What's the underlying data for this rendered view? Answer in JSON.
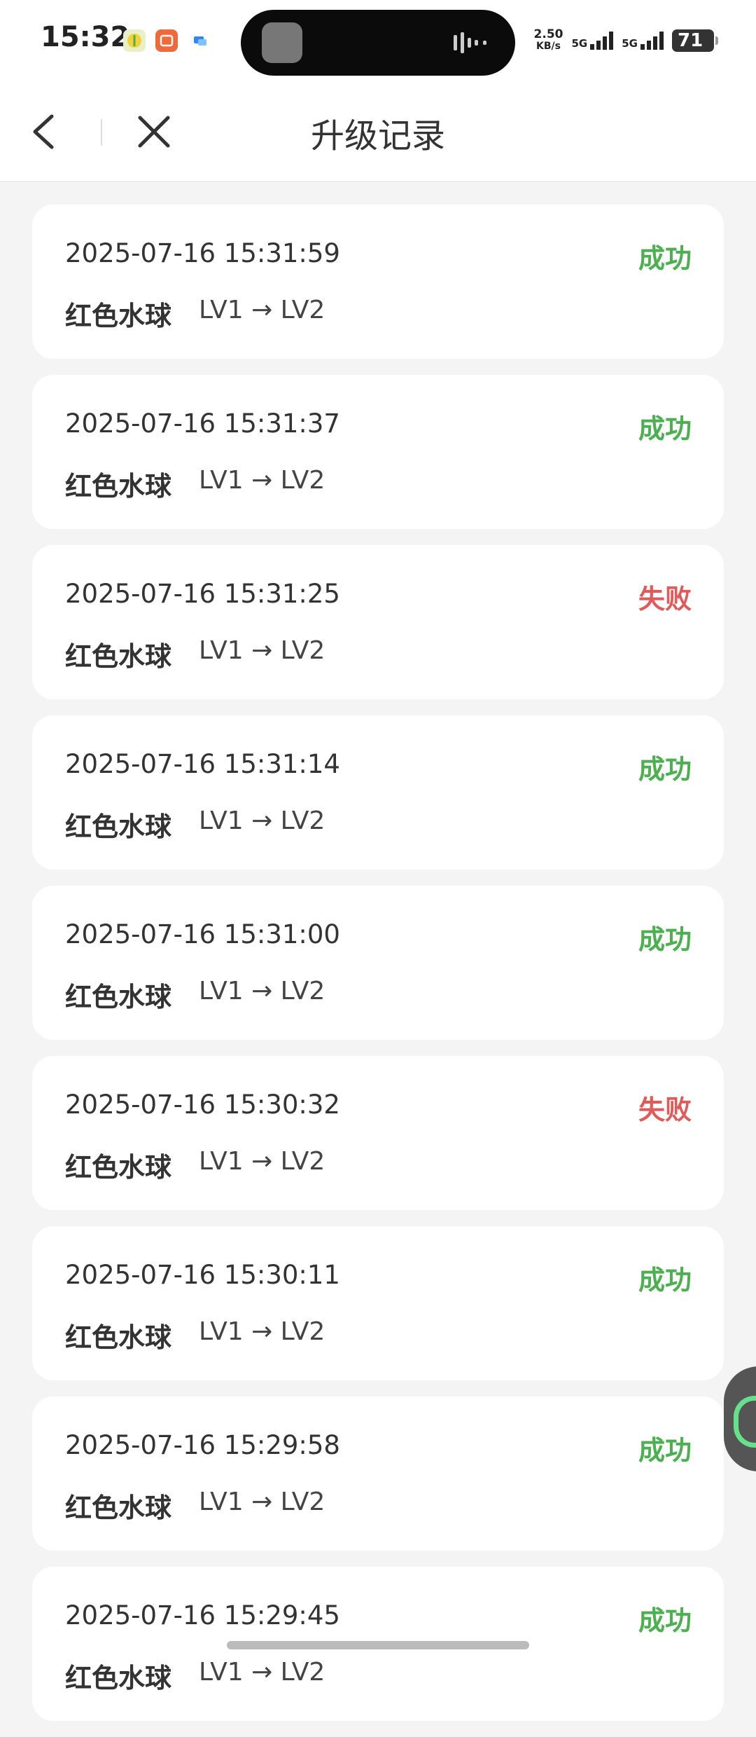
{
  "status_bar": {
    "time": "15:32",
    "speed_value": "2.50",
    "speed_unit": "KB/s",
    "net1": "5G",
    "net2": "5G",
    "battery": "71",
    "app_icon_1": "lemon-app-icon",
    "app_icon_2": "taobao-icon",
    "app_icon_3": "message-app-icon"
  },
  "header": {
    "title": "升级记录"
  },
  "records": [
    {
      "time": "2025-07-16 15:31:59",
      "status": "成功",
      "name": "红色水球",
      "level": "LV1 → LV2"
    },
    {
      "time": "2025-07-16 15:31:37",
      "status": "成功",
      "name": "红色水球",
      "level": "LV1 → LV2"
    },
    {
      "time": "2025-07-16 15:31:25",
      "status": "失败",
      "name": "红色水球",
      "level": "LV1 → LV2"
    },
    {
      "time": "2025-07-16 15:31:14",
      "status": "成功",
      "name": "红色水球",
      "level": "LV1 → LV2"
    },
    {
      "time": "2025-07-16 15:31:00",
      "status": "成功",
      "name": "红色水球",
      "level": "LV1 → LV2"
    },
    {
      "time": "2025-07-16 15:30:32",
      "status": "失败",
      "name": "红色水球",
      "level": "LV1 → LV2"
    },
    {
      "time": "2025-07-16 15:30:11",
      "status": "成功",
      "name": "红色水球",
      "level": "LV1 → LV2"
    },
    {
      "time": "2025-07-16 15:29:58",
      "status": "成功",
      "name": "红色水球",
      "level": "LV1 → LV2"
    },
    {
      "time": "2025-07-16 15:29:45",
      "status": "成功",
      "name": "红色水球",
      "level": "LV1 → LV2"
    }
  ],
  "colors": {
    "success": "#4caf50",
    "fail": "#e05a5a",
    "background": "#f4f4f4"
  }
}
